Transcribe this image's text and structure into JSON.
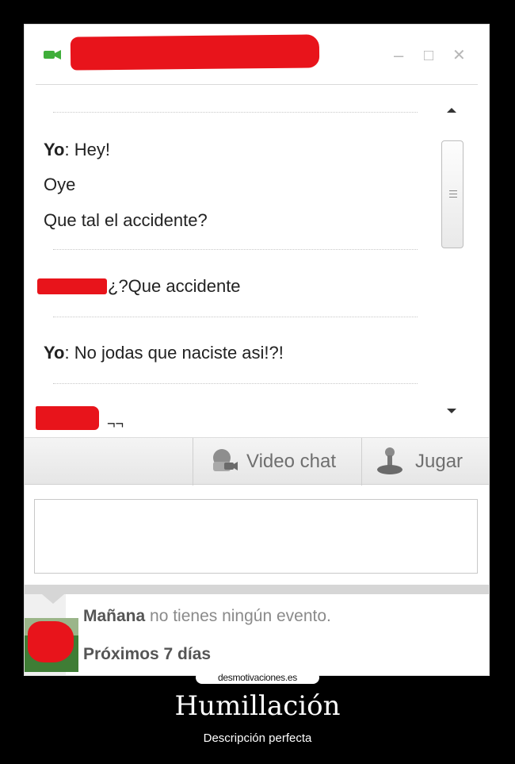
{
  "window": {
    "minimize": "–",
    "maximize": "□",
    "close": "✕"
  },
  "messages": [
    {
      "sender": "Yo",
      "sep": ": ",
      "text": "Hey!"
    },
    {
      "sender": "",
      "sep": "",
      "text": "Oye"
    },
    {
      "sender": "",
      "sep": "",
      "text": "Que tal el accidente?"
    },
    {
      "sender": "",
      "sep": "",
      "text": "¿?Que accidente"
    },
    {
      "sender": "Yo",
      "sep": ": ",
      "text": "No jodas que naciste asi!?!"
    },
    {
      "sender": "",
      "sep": "",
      "text": "¬¬"
    }
  ],
  "toolbar": {
    "video_chat": "Video chat",
    "jugar": "Jugar"
  },
  "events": {
    "manana_bold": "Mañana",
    "manana_rest": " no tienes ningún evento.",
    "proximos": "Próximos 7 días"
  },
  "footer": {
    "site": "desmotivaciones.es",
    "title": "Humillación",
    "subtitle": "Descripción perfecta"
  },
  "colors": {
    "redaction": "#e8141b",
    "camera": "#4caf50"
  },
  "icons": [
    "camera-icon",
    "scroll-up-icon",
    "scroll-down-icon",
    "video-chat-icon",
    "joystick-icon"
  ]
}
